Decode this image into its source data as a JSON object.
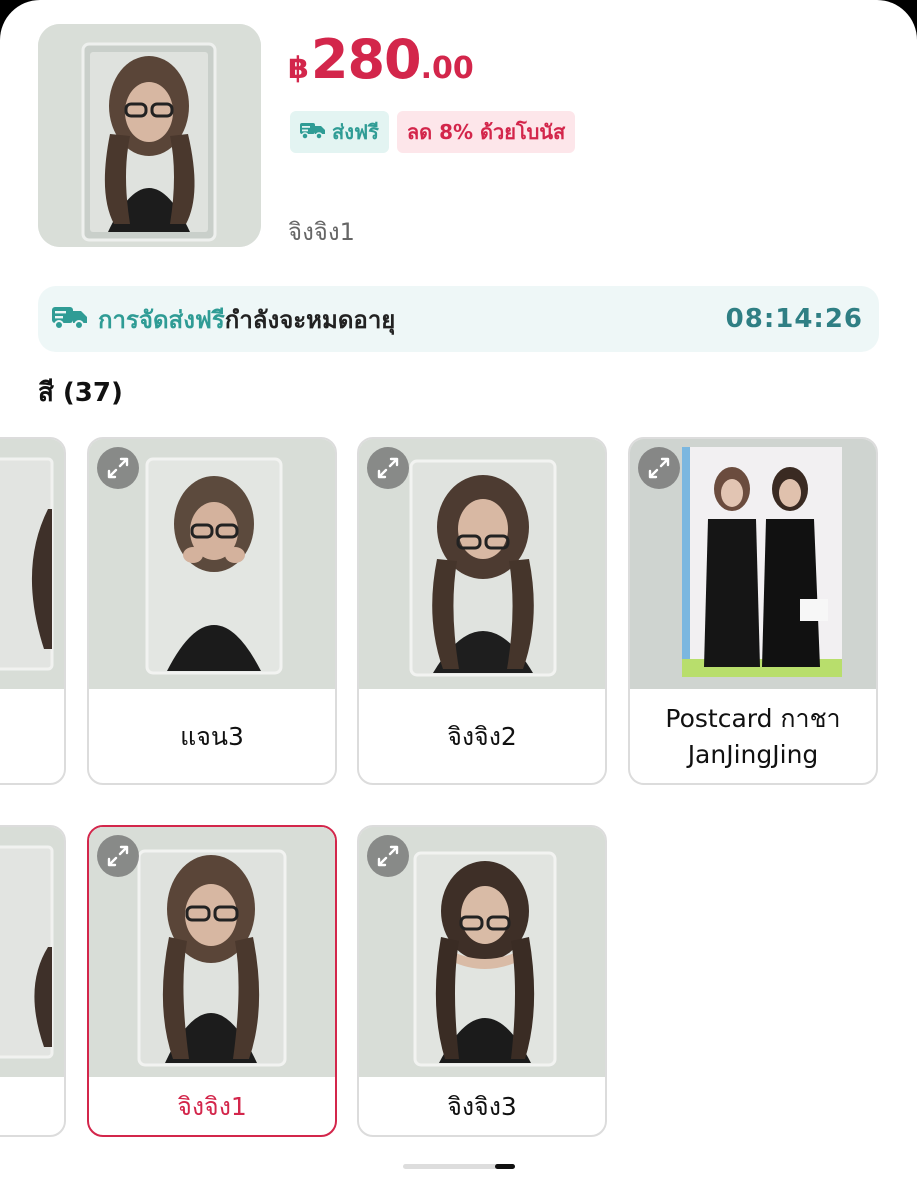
{
  "product": {
    "price_currency": "฿",
    "price_integer": "280",
    "price_decimal": ".00",
    "tag_free_shipping": "ส่งฟรี",
    "tag_discount": "ลด 8% ด้วยโบนัส",
    "selected_variant": "จิงจิง1"
  },
  "banner": {
    "text_teal": "การจัดส่งฟรี",
    "text_dark": "กำลังจะหมดอายุ",
    "timer": "08:14:26"
  },
  "section": {
    "title": "สี (37)"
  },
  "options": [
    {
      "label": "แจน3"
    },
    {
      "label": "จิงจิง2"
    },
    {
      "label": "Postcard กาชา JanJingJing"
    },
    {
      "label": "จิงจิง1",
      "selected": true
    },
    {
      "label": "จิงจิง3"
    }
  ],
  "colors": {
    "accent": "#d3264b",
    "teal": "#2f9c95"
  }
}
